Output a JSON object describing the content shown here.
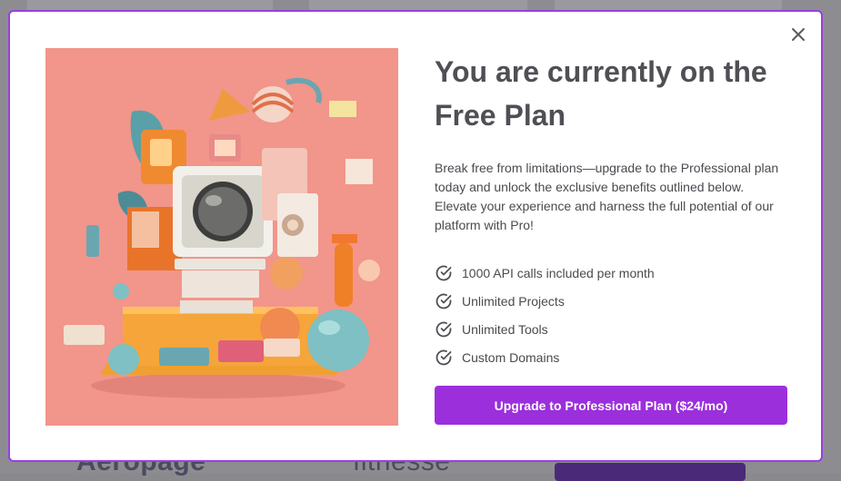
{
  "background": {
    "logo_left": "Aeropage",
    "logo_center": "fitnesse"
  },
  "modal": {
    "close_icon": "close-icon",
    "hero_image": "isometric-retro-computer-illustration",
    "title": "You are currently on the Free Plan",
    "description": "Break free from limitations—upgrade to the Professional plan today and unlock the exclusive benefits outlined below. Elevate your experience and harness the full potential of our platform with Pro!",
    "features": [
      {
        "label": "1000 API calls included per month",
        "icon": "check-circle-icon"
      },
      {
        "label": "Unlimited Projects",
        "icon": "check-circle-icon"
      },
      {
        "label": "Unlimited Tools",
        "icon": "check-circle-icon"
      },
      {
        "label": "Custom Domains",
        "icon": "check-circle-icon"
      }
    ],
    "upgrade_button": "Upgrade to Professional Plan ($24/mo)"
  },
  "colors": {
    "accent": "#9b2fdc",
    "modal_border": "#9b3fe0",
    "hero_bg": "#f2958a",
    "title_text": "#4f4f55"
  }
}
